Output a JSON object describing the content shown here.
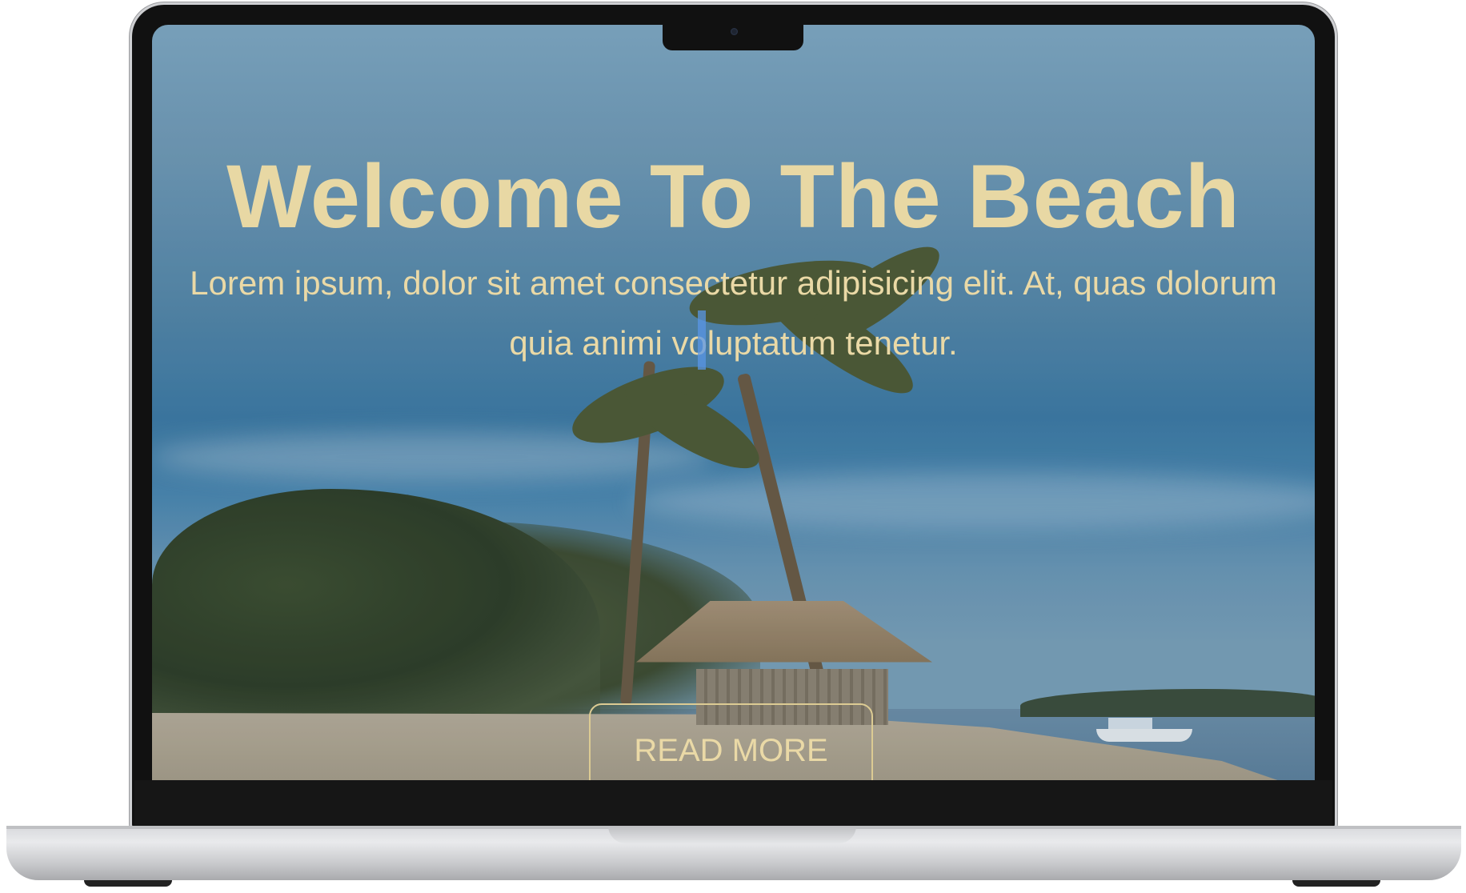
{
  "hero": {
    "title": "Welcome To The Beach",
    "text": "Lorem ipsum, dolor sit amet consectetur adipisicing elit. At, quas dolorum quia animi voluptatum tenetur.",
    "button_label": "READ MORE"
  },
  "colors": {
    "accent_text": "#e8d8a4",
    "button_border": "#dccb93",
    "device_frame": "#111111"
  },
  "icons": [
    "camera-icon"
  ]
}
